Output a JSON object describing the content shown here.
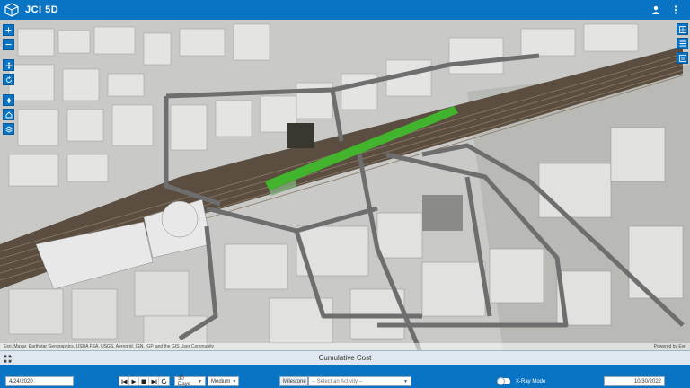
{
  "header": {
    "title": "JCI 5D",
    "logo_icon": "cube-logo-icon",
    "icons": [
      "user-icon",
      "more-vertical-icon"
    ]
  },
  "map": {
    "left_tools": [
      "zoom-in-icon",
      "zoom-out-icon",
      "pan-icon",
      "rotate-icon",
      "compass-icon",
      "home-icon",
      "layers-icon"
    ],
    "right_tools": [
      "basemap-gallery-icon",
      "list-icon",
      "legend-icon"
    ],
    "attribution": "Esri, Maxar, Earthstar Geographics, USDA FSA, USGS, Aerogrid, IGN, IGP, and the GIS User Community",
    "attribution_right": "Powered by Esri"
  },
  "cost_panel": {
    "title": "Cumulative Cost"
  },
  "controls": {
    "start_date": "4/24/2020",
    "end_date": "10/30/2022",
    "days_option": "30 Days",
    "speed_option": "Medium",
    "milestone_label": "Milestone",
    "activity_placeholder": "-- Select an Activity --",
    "xray_label": "X-Ray Mode",
    "playback_icons": [
      "skip-back-icon",
      "play-icon",
      "stop-icon",
      "skip-forward-icon",
      "replay-icon"
    ]
  },
  "colors": {
    "brand": "#0a74c4",
    "highlight": "#3fbf2a"
  }
}
